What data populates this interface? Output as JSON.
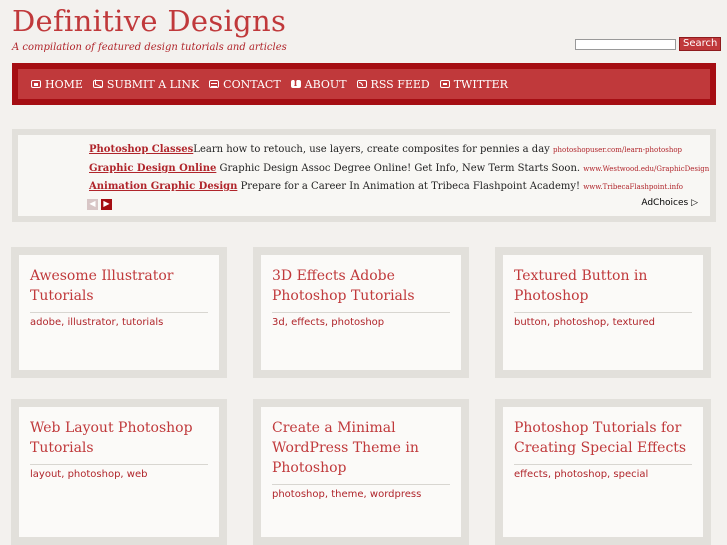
{
  "site": {
    "title": "Definitive Designs",
    "tagline": "A compilation of featured design tutorials and articles"
  },
  "search": {
    "placeholder": "",
    "value": "",
    "button_label": "Search"
  },
  "nav": [
    {
      "label": "HOME",
      "icon": "home-icon"
    },
    {
      "label": "SUBMIT A LINK",
      "icon": "envelope-icon"
    },
    {
      "label": "CONTACT",
      "icon": "contact-card-icon"
    },
    {
      "label": "ABOUT",
      "icon": "info-icon"
    },
    {
      "label": "RSS FEED",
      "icon": "rss-icon"
    },
    {
      "label": "TWITTER",
      "icon": "twitter-icon"
    }
  ],
  "ads": {
    "rows": [
      {
        "link": "Photoshop Classes",
        "text": "Learn how to retouch, use layers, create composites for pennies a day",
        "url": "photoshopuser.com/learn-photoshop"
      },
      {
        "link": "Graphic Design Online",
        "text": "Graphic Design Assoc Degree Online! Get Info, New Term Starts Soon.",
        "url": "www.Westwood.edu/GraphicDesign"
      },
      {
        "link": "Animation Graphic Design",
        "text": "Prepare for a Career In Animation at Tribeca Flashpoint Academy!",
        "url": "www.TribecaFlashpoint.info"
      }
    ],
    "adchoices_label": "AdChoices ▷"
  },
  "cards": [
    {
      "title": "Awesome Illustrator Tutorials",
      "tags": [
        "adobe",
        "illustrator",
        "tutorials"
      ]
    },
    {
      "title": "3D Effects Adobe Photoshop Tutorials",
      "tags": [
        "3d",
        "effects",
        "photoshop"
      ]
    },
    {
      "title": "Textured Button in Photoshop",
      "tags": [
        "button",
        "photoshop",
        "textured"
      ]
    },
    {
      "title": "Web Layout Photoshop Tutorials",
      "tags": [
        "layout",
        "photoshop",
        "web"
      ]
    },
    {
      "title": "Create a Minimal WordPress Theme in Photoshop",
      "tags": [
        "photoshop",
        "theme",
        "wordpress"
      ]
    },
    {
      "title": "Photoshop Tutorials for Creating Special Effects",
      "tags": [
        "effects",
        "photoshop",
        "special"
      ]
    }
  ],
  "colors": {
    "brand": "#c0393b",
    "nav_border": "#a50e13",
    "background": "#f3f1ee"
  }
}
